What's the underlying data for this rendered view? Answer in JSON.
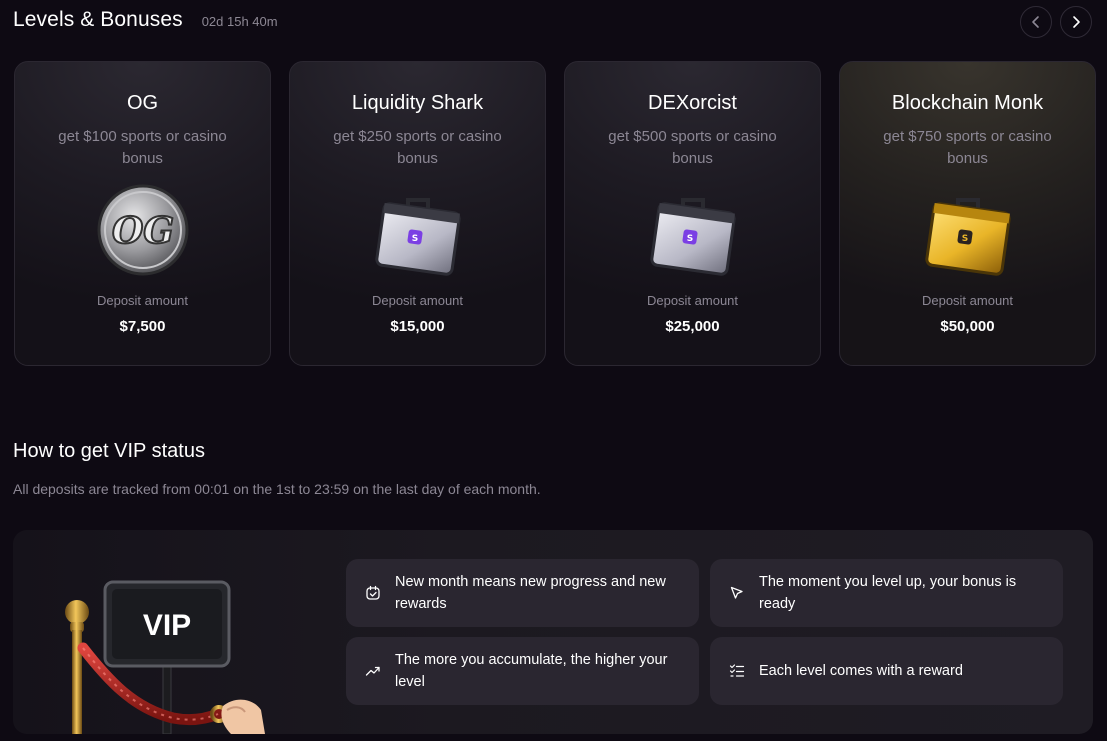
{
  "header": {
    "title": "Levels & Bonuses",
    "timer": "02d 15h 40m"
  },
  "levels": [
    {
      "name": "OG",
      "bonus": "get $100 sports or casino bonus",
      "deposit_label": "Deposit amount",
      "deposit": "$7,500",
      "image": "og-coin-icon"
    },
    {
      "name": "Liquidity Shark",
      "bonus": "get $250 sports or casino bonus",
      "deposit_label": "Deposit amount",
      "deposit": "$15,000",
      "image": "silver-briefcase-icon"
    },
    {
      "name": "DEXorcist",
      "bonus": "get $500 sports or casino bonus",
      "deposit_label": "Deposit amount",
      "deposit": "$25,000",
      "image": "silver-briefcase-icon"
    },
    {
      "name": "Blockchain Monk",
      "bonus": "get $750 sports or casino bonus",
      "deposit_label": "Deposit amount",
      "deposit": "$50,000",
      "image": "gold-briefcase-icon"
    }
  ],
  "vip": {
    "title": "How to get VIP status",
    "subtitle": "All deposits are tracked from 00:01 on the 1st to 23:59 on the last day of each month.",
    "sign_text": "VIP",
    "features": [
      {
        "icon": "calendar-check-icon",
        "text": "New month means new progress and new rewards"
      },
      {
        "icon": "cursor-arrow-icon",
        "text": "The moment you level up, your bonus is ready"
      },
      {
        "icon": "trending-up-icon",
        "text": "The more you accumulate, the higher your level"
      },
      {
        "icon": "checklist-icon",
        "text": "Each level comes with a reward"
      }
    ]
  },
  "colors": {
    "background": "#0e0a13",
    "card": "#1d1a22",
    "muted_text": "#8c8794",
    "feature_bg": "#2a2630",
    "briefcase_badge": "#7b3fe4",
    "gold": "#e9b528"
  }
}
